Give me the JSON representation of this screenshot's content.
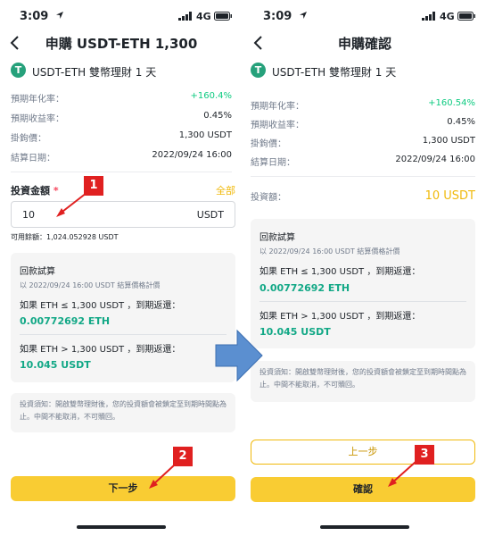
{
  "status_bar": {
    "time": "3:09",
    "network": "4G"
  },
  "left_screen": {
    "title": "申購 USDT-ETH 1,300",
    "coin_letter": "T",
    "product_name": "USDT-ETH 雙幣理財 1 天",
    "rows": [
      {
        "label": "預期年化率：",
        "value": "+160.4%"
      },
      {
        "label": "預期收益率：",
        "value": "0.45%"
      },
      {
        "label": "掛鉤價：",
        "value": "1,300 USDT"
      },
      {
        "label": "結算日期：",
        "value": "2022/09/24 16:00"
      }
    ],
    "amount_label": "投資金額",
    "required_mark": "*",
    "all_label": "全部",
    "amount_value": "10",
    "amount_unit": "USDT",
    "available": "可用餘額：1,024.052928 USDT",
    "calc": {
      "title": "回款試算",
      "subtitle": "以 2022/09/24 16:00 USDT 結算價格計價",
      "case1": "如果 ETH ≤ 1,300 USDT ，到期返還：",
      "case1_value": "0.00772692 ETH",
      "case2": "如果 ETH > 1,300 USDT ，到期返還：",
      "case2_value": "10.045 USDT"
    },
    "notice": "投資須知：開啟雙幣理財後，您的投資額會被鎖定至到期時間點為止。中間不能取消，不可贖回。",
    "next_button": "下一步",
    "marker1": "1",
    "marker2": "2"
  },
  "right_screen": {
    "title": "申購確認",
    "coin_letter": "T",
    "product_name": "USDT-ETH 雙幣理財 1 天",
    "rows": [
      {
        "label": "預期年化率：",
        "value": "+160.54%"
      },
      {
        "label": "預期收益率：",
        "value": "0.45%"
      },
      {
        "label": "掛鉤價：",
        "value": "1,300 USDT"
      },
      {
        "label": "結算日期：",
        "value": "2022/09/24 16:00"
      }
    ],
    "invest_label": "投資額：",
    "invest_value": "10 USDT",
    "calc": {
      "title": "回款試算",
      "subtitle": "以 2022/09/24 16:00 USDT 結算價格計價",
      "case1": "如果 ETH ≤ 1,300 USDT ，到期返還：",
      "case1_value": "0.00772692 ETH",
      "case2": "如果 ETH > 1,300 USDT ，到期返還：",
      "case2_value": "10.045 USDT"
    },
    "notice": "投資須知：開啟雙幣理財後，您的投資額會被鎖定至到期時間點為止。中間不能取消，不可贖回。",
    "prev_button": "上一步",
    "confirm_button": "確認",
    "marker3": "3"
  },
  "colors": {
    "accent": "#f0b90b",
    "green": "#0ecb81",
    "marker": "#e02020",
    "arrow": "#5b8fd0"
  }
}
